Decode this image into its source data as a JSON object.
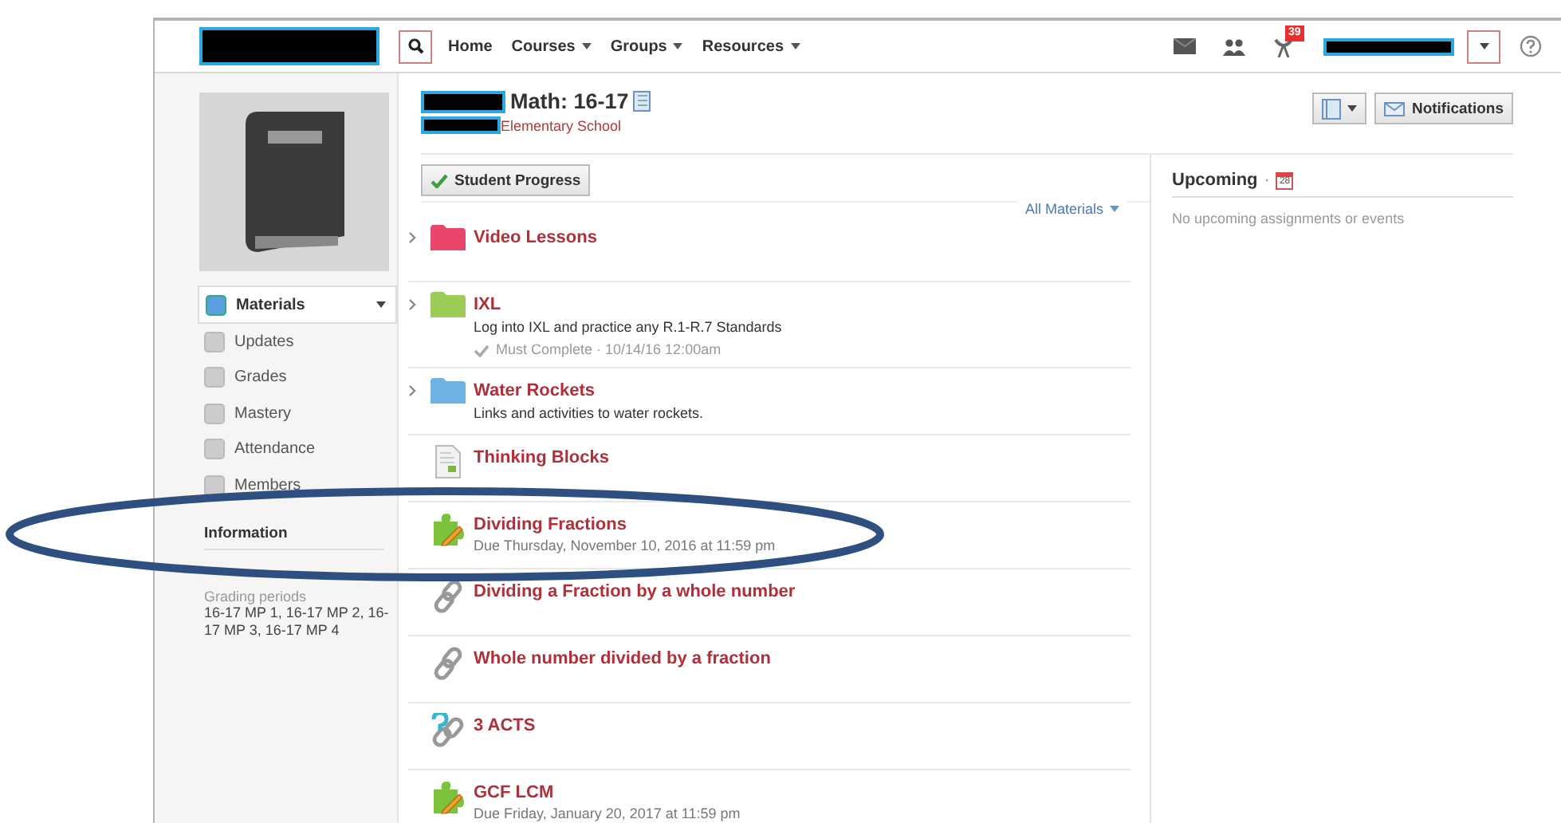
{
  "header": {
    "nav": [
      {
        "label": "Home",
        "menu": false
      },
      {
        "label": "Courses",
        "menu": true
      },
      {
        "label": "Groups",
        "menu": true
      },
      {
        "label": "Resources",
        "menu": true
      }
    ],
    "badge": "39"
  },
  "sidebar": {
    "items": [
      {
        "label": "Materials",
        "selected": true
      },
      {
        "label": "Updates",
        "selected": false
      },
      {
        "label": "Grades",
        "selected": false
      },
      {
        "label": "Mastery",
        "selected": false
      },
      {
        "label": "Attendance",
        "selected": false
      },
      {
        "label": "Members",
        "selected": false
      }
    ],
    "info_title": "Information",
    "grading_label": "Grading periods",
    "grading_value": "16-17 MP 1, 16-17 MP 2, 16-17 MP 3, 16-17 MP 4"
  },
  "course": {
    "title": "Math: 16-17",
    "school": "Elementary School",
    "notifications": "Notifications"
  },
  "materials": {
    "progress_button": "Student Progress",
    "filter": "All Materials",
    "items": [
      {
        "kind": "folder",
        "color": "#e8476b",
        "title": "Video Lessons"
      },
      {
        "kind": "folder",
        "color": "#9ccb57",
        "title": "IXL",
        "description": "Log into IXL and practice any R.1-R.7 Standards",
        "meta": "Must Complete · 10/14/16 12:00am"
      },
      {
        "kind": "folder",
        "color": "#6eb2e3",
        "title": "Water Rockets",
        "description": "Links and activities to water rockets."
      },
      {
        "kind": "page",
        "title": "Thinking Blocks"
      },
      {
        "kind": "assignment",
        "title": "Dividing Fractions",
        "due": "Due Thursday, November 10, 2016 at 11:59 pm"
      },
      {
        "kind": "link",
        "title": "Dividing a Fraction by a whole number"
      },
      {
        "kind": "link",
        "title": "Whole number divided by a fraction"
      },
      {
        "kind": "external",
        "title": "3 ACTS"
      },
      {
        "kind": "assignment",
        "title": "GCF LCM",
        "due": "Due Friday, January 20, 2017 at 11:59 pm"
      }
    ]
  },
  "upcoming": {
    "title": "Upcoming",
    "separator": "·",
    "calendar_day": "28",
    "empty": "No upcoming assignments or events"
  }
}
